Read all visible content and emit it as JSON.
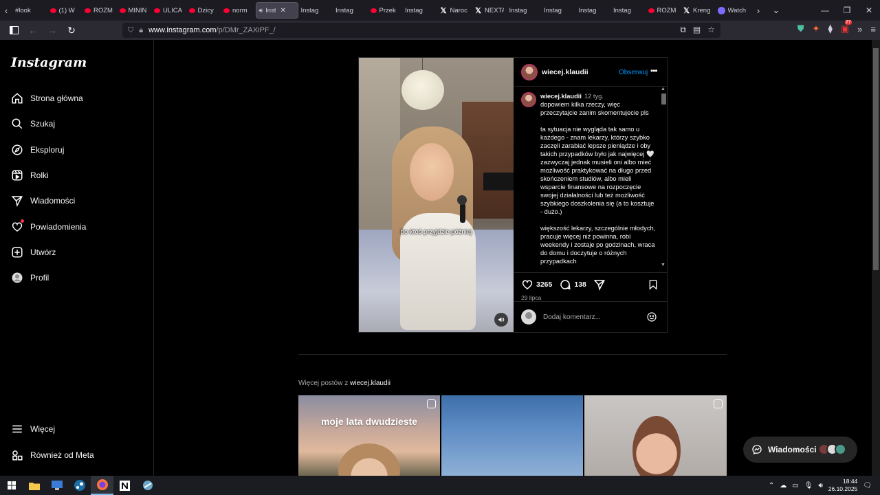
{
  "browser": {
    "tabs": [
      {
        "label": "#look",
        "icon": "none"
      },
      {
        "label": "(1) W",
        "icon": "youtube"
      },
      {
        "label": "ROZM",
        "icon": "youtube"
      },
      {
        "label": "MININ",
        "icon": "youtube"
      },
      {
        "label": "ULICA",
        "icon": "youtube"
      },
      {
        "label": "Dzicy",
        "icon": "youtube"
      },
      {
        "label": "norm",
        "icon": "youtube"
      },
      {
        "label": "Inst",
        "icon": "instagram",
        "active": true,
        "audio": true
      },
      {
        "label": "Instag",
        "icon": "instagram"
      },
      {
        "label": "Instag",
        "icon": "instagram"
      },
      {
        "label": "Przek",
        "icon": "youtube"
      },
      {
        "label": "Instag",
        "icon": "instagram"
      },
      {
        "label": "Naroc",
        "icon": "x"
      },
      {
        "label": "NEXTA",
        "icon": "x"
      },
      {
        "label": "Instag",
        "icon": "instagram"
      },
      {
        "label": "Instag",
        "icon": "instagram"
      },
      {
        "label": "Instag",
        "icon": "instagram"
      },
      {
        "label": "Instag",
        "icon": "instagram"
      },
      {
        "label": "ROZM",
        "icon": "youtube"
      },
      {
        "label": "Kreng",
        "icon": "x"
      },
      {
        "label": "Watch",
        "icon": "chatgpt"
      }
    ],
    "url_host": "www.instagram.com",
    "url_path": "/p/DMr_ZAXiPF_/",
    "extensions_badge": "27"
  },
  "sidebar": {
    "logo": "Instagram",
    "items": [
      {
        "label": "Strona główna",
        "icon": "home-icon"
      },
      {
        "label": "Szukaj",
        "icon": "search-icon"
      },
      {
        "label": "Eksploruj",
        "icon": "compass-icon"
      },
      {
        "label": "Rolki",
        "icon": "reels-icon"
      },
      {
        "label": "Wiadomości",
        "icon": "send-icon"
      },
      {
        "label": "Powiadomienia",
        "icon": "heart-icon"
      },
      {
        "label": "Utwórz",
        "icon": "plus-square-icon"
      },
      {
        "label": "Profil",
        "icon": "profile-icon"
      }
    ],
    "bottom": [
      {
        "label": "Więcej",
        "icon": "menu-icon"
      },
      {
        "label": "Również od Meta",
        "icon": "meta-icon"
      }
    ]
  },
  "post": {
    "subtitle": "bo ktoś przyjdzie później",
    "username": "wiecej.klaudii",
    "follow_label": "Obserwuj",
    "caption_time": "12 tyg.",
    "caption_paragraphs": [
      "dopowiem kilka rzeczy, więc przeczytajcie zanim skomentujecie pls",
      "ta sytuacja nie wygląda tak samo u każdego - znam lekarzy, którzy szybko zaczęli zarabiać lepsze pieniądze i oby takich przypadków było jak najwięcej 🤍 zazwyczaj jednak musieli oni albo mieć możliwość praktykować na długo przed skończeniem studiów, albo mieli wsparcie finansowe na rozpoczęcie swojej działalności lub też możliwość szybkiego doszkolenia się (a to kosztuje - dużo.)",
      "większość lekarzy, szczególnie młodych, pracuje więcej niż powinna, robi weekendy i zostaje po godzinach, wraca do domu i doczytuje o różnych przypadkach"
    ],
    "likes": "3265",
    "comments": "138",
    "date": "29 lipca",
    "comment_placeholder": "Dodaj komentarz..."
  },
  "more_posts": {
    "prefix": "Więcej postów z",
    "username": "wiecej.klaudii",
    "thumbnails": [
      {
        "text": "moje lata dwudzieste"
      },
      {
        "text": ""
      },
      {
        "text": ""
      }
    ]
  },
  "messages_pill": {
    "label": "Wiadomości"
  },
  "taskbar": {
    "time": "18:44",
    "date": "26.10.2025"
  }
}
